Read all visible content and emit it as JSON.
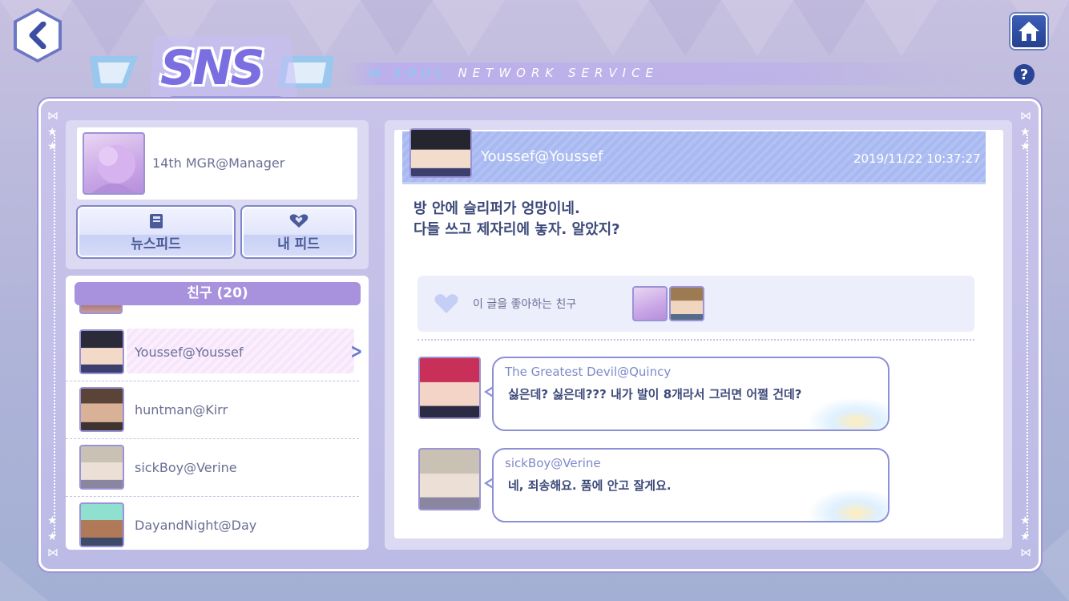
{
  "header": {
    "logo_text": "SNS",
    "tagline_soul": "SOUL",
    "tagline_rest": "NETWORK SERVICE",
    "back_icon": "chevron-left-icon",
    "home_icon": "home-icon",
    "help_label": "?"
  },
  "profile": {
    "name": "14th MGR@Manager"
  },
  "nav": {
    "newsfeed_label": "뉴스피드",
    "myfeed_label": "내 피드"
  },
  "friends": {
    "header": "친구 (20)",
    "items": [
      {
        "name": "Youssef@Youssef",
        "selected": true
      },
      {
        "name": "huntman@Kirr",
        "selected": false
      },
      {
        "name": "sickBoy@Verine",
        "selected": false
      },
      {
        "name": "DayandNight@Day",
        "selected": false
      }
    ]
  },
  "post": {
    "author": "Youssef@Youssef",
    "timestamp": "2019/11/22 10:37:27",
    "line1": "방 안에 슬리퍼가 엉망이네.",
    "line2": "다들 쓰고 제자리에 놓자. 알았지?",
    "likes_label": "이 글을 좋아하는 친구"
  },
  "comments": [
    {
      "name": "The Greatest Devil@Quincy",
      "text": "싫은데? 싫은데??? 내가 발이 8개라서 그러면 어쩔 건데?"
    },
    {
      "name": "sickBoy@Verine",
      "text": "네, 죄송해요. 품에 안고 잘게요."
    }
  ],
  "colors": {
    "accent": "#a992dd",
    "header_stripe": "#b2c1f4",
    "text_dark": "#3d4a7a",
    "text_muted": "#6a6f93"
  }
}
